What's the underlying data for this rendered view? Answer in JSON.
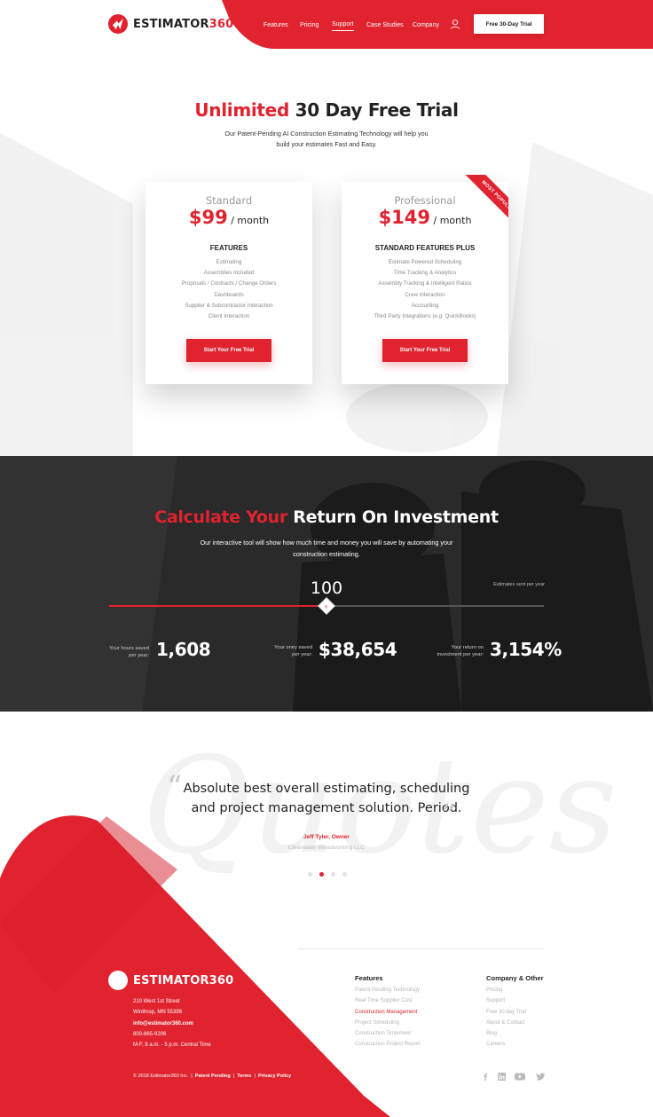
{
  "brand": {
    "name_dark": "ESTIMATOR",
    "name_red": "360",
    "accent": "#e0232e"
  },
  "nav": {
    "items": [
      "Features",
      "Pricing",
      "Support",
      "Case Studies",
      "Company"
    ],
    "active": "Support",
    "cta": "Free 30-Day Trial"
  },
  "hero": {
    "title_red": "Unlimited",
    "title_dark": "30 Day Free Trial",
    "subtitle": "Our Patent-Pending AI Construction Estimating Technology will help you build your estimates Fast and Easy."
  },
  "plans": [
    {
      "tier": "Standard",
      "price": "$99",
      "period": "/ month",
      "features_heading": "FEATURES",
      "features": [
        "Estimating",
        "Assemblies Included",
        "Proposals / Contracts / Change Orders",
        "Dashboards",
        "Supplier & Subcontractor Interaction",
        "Client Interaction"
      ],
      "cta": "Start Your Free Trial"
    },
    {
      "tier": "Professional",
      "price": "$149",
      "period": "/ month",
      "badge": "MOST POPULAR",
      "features_heading": "STANDARD FEATURES PLUS",
      "features": [
        "Estimate Powered Scheduling",
        "Time Tracking & Analytics",
        "Assembly Tracking & Intelligent Ratios",
        "Crew Interaction",
        "Accounting",
        "Third Party Integrations (e.g. QuickBooks)"
      ],
      "cta": "Start Your Free Trial"
    }
  ],
  "roi": {
    "title_red": "Calculate Your",
    "title_white": "Return On Investment",
    "subtitle": "Our interactive tool will show how much time and money you will save by automating your construction estimating.",
    "slider_value": "100",
    "slider_fraction": 0.5,
    "slider_label": "Estimates sent per year",
    "stats": [
      {
        "label": "Your hours saved per year:",
        "value": "1,608"
      },
      {
        "label": "Your oney saved per year:",
        "value": "$38,654"
      },
      {
        "label": "Your return on investment per year:",
        "value": "3,154%"
      }
    ]
  },
  "testimonial": {
    "quote": "Absolute best overall estimating, scheduling and project management solution. Period.",
    "author": "Jeff Tyler, Owner",
    "company": "Clearwater Woodworking LLC",
    "dots": 4,
    "active_dot": 1
  },
  "footer": {
    "address": [
      "210 West 1st Street",
      "Winthrop, MN 55396"
    ],
    "email": "info@estimator360.com",
    "phone": "800-865-9206",
    "hours": "M-F, 8 a.m. - 5 p.m. Central Time",
    "features_heading": "Features",
    "features": [
      "Patent Pending Technology",
      "Real Time Supplier Cost",
      "Construction Management",
      "Project Scheduling",
      "Construction Timesheet",
      "Construction Project Report"
    ],
    "features_highlight": 2,
    "company_heading": "Company & Other",
    "company_links": [
      "Pricing",
      "Support",
      "Free 30 day Trial",
      "About & Contact",
      "Blog",
      "Careers"
    ],
    "copyright": "© 2018 Estimator360 Inc.",
    "legal": [
      "Patent Pending",
      "Terms",
      "Privacy Policy"
    ],
    "social_icons": [
      "facebook-icon",
      "linkedin-icon",
      "youtube-icon",
      "twitter-icon"
    ]
  }
}
